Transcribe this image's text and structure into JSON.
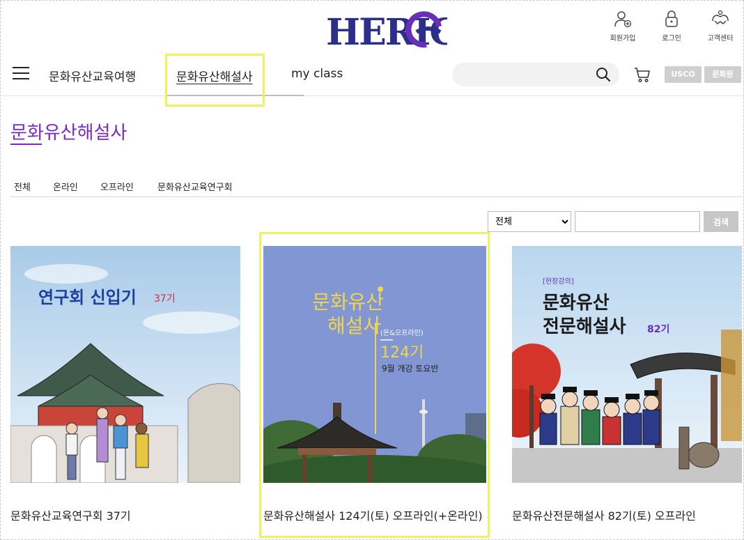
{
  "header": {
    "logo_text": "HERIG",
    "utils": [
      {
        "label": "회원가입",
        "icon": "user-add-icon"
      },
      {
        "label": "로그인",
        "icon": "lock-icon"
      },
      {
        "label": "고객센터",
        "icon": "support-icon"
      }
    ],
    "nav": [
      {
        "label": "문화유산교육여행"
      },
      {
        "label": "문화유산해설사",
        "active": true
      },
      {
        "label": "my class"
      }
    ],
    "search_placeholder": "",
    "pills": [
      "USCO",
      "문화원"
    ]
  },
  "page": {
    "title": "문화유산해설사",
    "filter_tabs": [
      "전체",
      "온라인",
      "오프라인",
      "문화유산교육연구회"
    ],
    "search": {
      "select_value": "전체",
      "options": [
        "전체"
      ],
      "keyword": "",
      "button": "검색"
    }
  },
  "cards": [
    {
      "title": "문화유산교육연구회 37기",
      "thumb": {
        "headline": "연구회 신입기",
        "tag": "37기"
      }
    },
    {
      "title": "문화유산해설사 124기(토) 오프라인(+온라인)",
      "thumb": {
        "line1": "문화유산",
        "line2": "해설사",
        "mode": "(온&오프라인)",
        "num": "124기",
        "sub": "9월 개강 토요반"
      }
    },
    {
      "title": "문화유산전문해설사 82기(토) 오프라인",
      "thumb": {
        "tag": "[현장강의]",
        "line1": "문화유산",
        "line2": "전문해설사",
        "num": "82기"
      }
    }
  ],
  "colors": {
    "accent": "#7a28c9",
    "logo": "#2b2f8a",
    "highlight": "#eef35a"
  }
}
